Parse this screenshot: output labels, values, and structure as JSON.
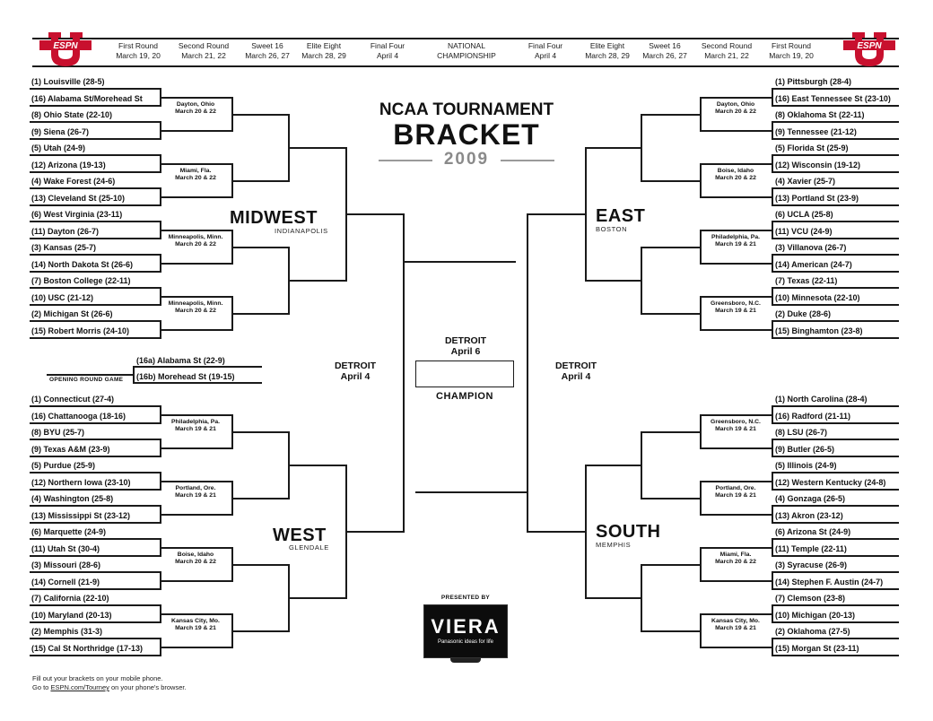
{
  "header": {
    "left_rounds": [
      {
        "name": "First Round",
        "date": "March 19, 20"
      },
      {
        "name": "Second Round",
        "date": "March 21, 22"
      },
      {
        "name": "Sweet 16",
        "date": "March 26, 27"
      },
      {
        "name": "Elite Eight",
        "date": "March 28, 29"
      },
      {
        "name": "Final Four",
        "date": "April 4"
      }
    ],
    "center_round": {
      "name": "NATIONAL",
      "date": "CHAMPIONSHIP"
    },
    "right_rounds": [
      {
        "name": "Final Four",
        "date": "April 4"
      },
      {
        "name": "Elite Eight",
        "date": "March 28, 29"
      },
      {
        "name": "Sweet 16",
        "date": "March 26, 27"
      },
      {
        "name": "Second Round",
        "date": "March 21, 22"
      },
      {
        "name": "First Round",
        "date": "March 19, 20"
      }
    ],
    "logo_text": "ESPN",
    "logo_color": "#c8102e"
  },
  "title": {
    "line1": "NCAA TOURNAMENT",
    "line2": "BRACKET",
    "year": "2009"
  },
  "regions": {
    "midwest": {
      "name": "MIDWEST",
      "city": "INDIANAPOLIS",
      "teams": [
        "(1) Louisville (28-5)",
        "(16) Alabama St/Morehead St",
        "(8) Ohio State (22-10)",
        "(9) Siena (26-7)",
        "(5) Utah (24-9)",
        "(12) Arizona (19-13)",
        "(4) Wake Forest (24-6)",
        "(13) Cleveland St (25-10)",
        "(6) West Virginia (23-11)",
        "(11) Dayton (26-7)",
        "(3) Kansas (25-7)",
        "(14) North Dakota St (26-6)",
        "(7) Boston College (22-11)",
        "(10) USC (21-12)",
        "(2) Michigan St (26-6)",
        "(15) Robert Morris (24-10)"
      ],
      "sites": [
        {
          "city": "Dayton, Ohio",
          "dates": "March 20 & 22"
        },
        {
          "city": "Miami, Fla.",
          "dates": "March 20 & 22"
        },
        {
          "city": "Minneapolis, Minn.",
          "dates": "March 20 & 22"
        },
        {
          "city": "Minneapolis, Minn.",
          "dates": "March 20 & 22"
        }
      ]
    },
    "west": {
      "name": "WEST",
      "city": "GLENDALE",
      "teams": [
        "(1) Connecticut (27-4)",
        "(16) Chattanooga (18-16)",
        "(8) BYU (25-7)",
        "(9) Texas A&M (23-9)",
        "(5) Purdue (25-9)",
        "(12) Northern Iowa (23-10)",
        "(4) Washington (25-8)",
        "(13) Mississippi St (23-12)",
        "(6) Marquette (24-9)",
        "(11) Utah St (30-4)",
        "(3) Missouri (28-6)",
        "(14) Cornell (21-9)",
        "(7) California (22-10)",
        "(10) Maryland (20-13)",
        "(2) Memphis (31-3)",
        "(15) Cal St Northridge (17-13)"
      ],
      "sites": [
        {
          "city": "Philadelphia, Pa.",
          "dates": "March 19 & 21"
        },
        {
          "city": "Portland, Ore.",
          "dates": "March 19 & 21"
        },
        {
          "city": "Boise, Idaho",
          "dates": "March 20 & 22"
        },
        {
          "city": "Kansas City, Mo.",
          "dates": "March 19 & 21"
        }
      ]
    },
    "east": {
      "name": "EAST",
      "city": "BOSTON",
      "teams": [
        "(1) Pittsburgh (28-4)",
        "(16) East Tennessee St (23-10)",
        "(8) Oklahoma St (22-11)",
        "(9) Tennessee (21-12)",
        "(5) Florida St (25-9)",
        "(12) Wisconsin (19-12)",
        "(4) Xavier (25-7)",
        "(13) Portland St (23-9)",
        "(6) UCLA (25-8)",
        "(11) VCU (24-9)",
        "(3) Villanova (26-7)",
        "(14) American (24-7)",
        "(7) Texas (22-11)",
        "(10) Minnesota (22-10)",
        "(2) Duke (28-6)",
        "(15) Binghamton (23-8)"
      ],
      "sites": [
        {
          "city": "Dayton, Ohio",
          "dates": "March 20 & 22"
        },
        {
          "city": "Boise, Idaho",
          "dates": "March 20 & 22"
        },
        {
          "city": "Philadelphia, Pa.",
          "dates": "March 19 & 21"
        },
        {
          "city": "Greensboro, N.C.",
          "dates": "March 19 & 21"
        }
      ]
    },
    "south": {
      "name": "SOUTH",
      "city": "MEMPHIS",
      "teams": [
        "(1) North Carolina (28-4)",
        "(16) Radford (21-11)",
        "(8) LSU (26-7)",
        "(9) Butler (26-5)",
        "(5) Illinois (24-9)",
        "(12) Western Kentucky (24-8)",
        "(4) Gonzaga (26-5)",
        "(13) Akron (23-12)",
        "(6) Arizona St (24-9)",
        "(11) Temple (22-11)",
        "(3) Syracuse (26-9)",
        "(14) Stephen F. Austin (24-7)",
        "(7) Clemson (23-8)",
        "(10) Michigan (20-13)",
        "(2) Oklahoma (27-5)",
        "(15) Morgan St (23-11)"
      ],
      "sites": [
        {
          "city": "Greensboro, N.C.",
          "dates": "March 19 & 21"
        },
        {
          "city": "Portland, Ore.",
          "dates": "March 19 & 21"
        },
        {
          "city": "Miami, Fla.",
          "dates": "March 20 & 22"
        },
        {
          "city": "Kansas City, Mo.",
          "dates": "March 19 & 21"
        }
      ]
    }
  },
  "opening_round": {
    "label": "OPENING ROUND GAME",
    "teams": [
      "(16a) Alabama St (22-9)",
      "(16b) Morehead St (19-15)"
    ]
  },
  "final_four": {
    "left": {
      "city": "DETROIT",
      "date": "April 4"
    },
    "right": {
      "city": "DETROIT",
      "date": "April 4"
    },
    "championship": {
      "city": "DETROIT",
      "date": "April 6"
    },
    "champion_label": "CHAMPION"
  },
  "sponsor": {
    "presented_by": "PRESENTED BY",
    "brand": "VIERA",
    "tagline": "Panasonic ideas for life"
  },
  "footer": {
    "line1": "Fill out your brackets on your mobile phone.",
    "line2_prefix": "Go to ",
    "link": "ESPN.com/Tourney",
    "line2_suffix": " on your phone's browser."
  }
}
